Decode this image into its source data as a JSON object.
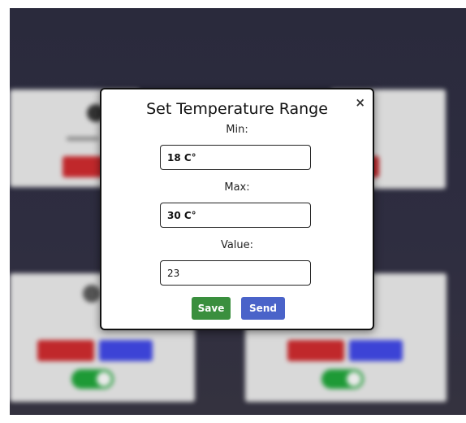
{
  "modal": {
    "title": "Set Temperature Range",
    "close_label": "×",
    "min": {
      "label": "Min:",
      "value": "18 C°"
    },
    "max": {
      "label": "Max:",
      "value": "30 C°"
    },
    "current": {
      "label": "Value:",
      "value": "23"
    },
    "save_label": "Save",
    "send_label": "Send"
  },
  "colors": {
    "save": "#3a8f3e",
    "send": "#4a63c9",
    "overlay": "#2b2a3d"
  }
}
